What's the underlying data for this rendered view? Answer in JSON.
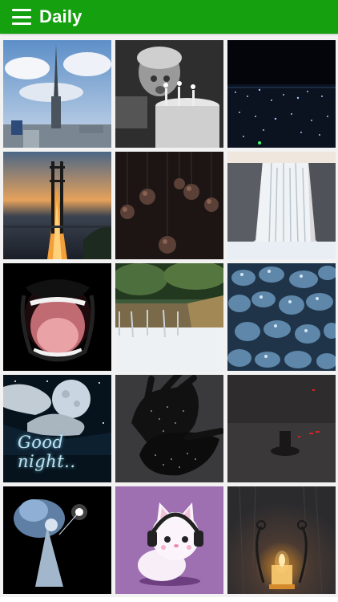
{
  "app": {
    "title": "Daily",
    "menu_icon": "hamburger-menu-icon",
    "accent_color": "#15a00f"
  },
  "tiles": [
    {
      "subject": "skyscraper-tower"
    },
    {
      "subject": "child-birthday-cake"
    },
    {
      "subject": "city-at-night"
    },
    {
      "subject": "bridge-at-dusk"
    },
    {
      "subject": "hanging-light-bulbs"
    },
    {
      "subject": "waterfall"
    },
    {
      "subject": "open-mouth"
    },
    {
      "subject": "river-rapids"
    },
    {
      "subject": "blue-stones"
    },
    {
      "subject": "good-night-moon",
      "caption": "Good night.."
    },
    {
      "subject": "sparkling-hands"
    },
    {
      "subject": "dark-scene"
    },
    {
      "subject": "fairy-with-light"
    },
    {
      "subject": "cartoon-cat-headphones"
    },
    {
      "subject": "candle-lantern"
    }
  ]
}
